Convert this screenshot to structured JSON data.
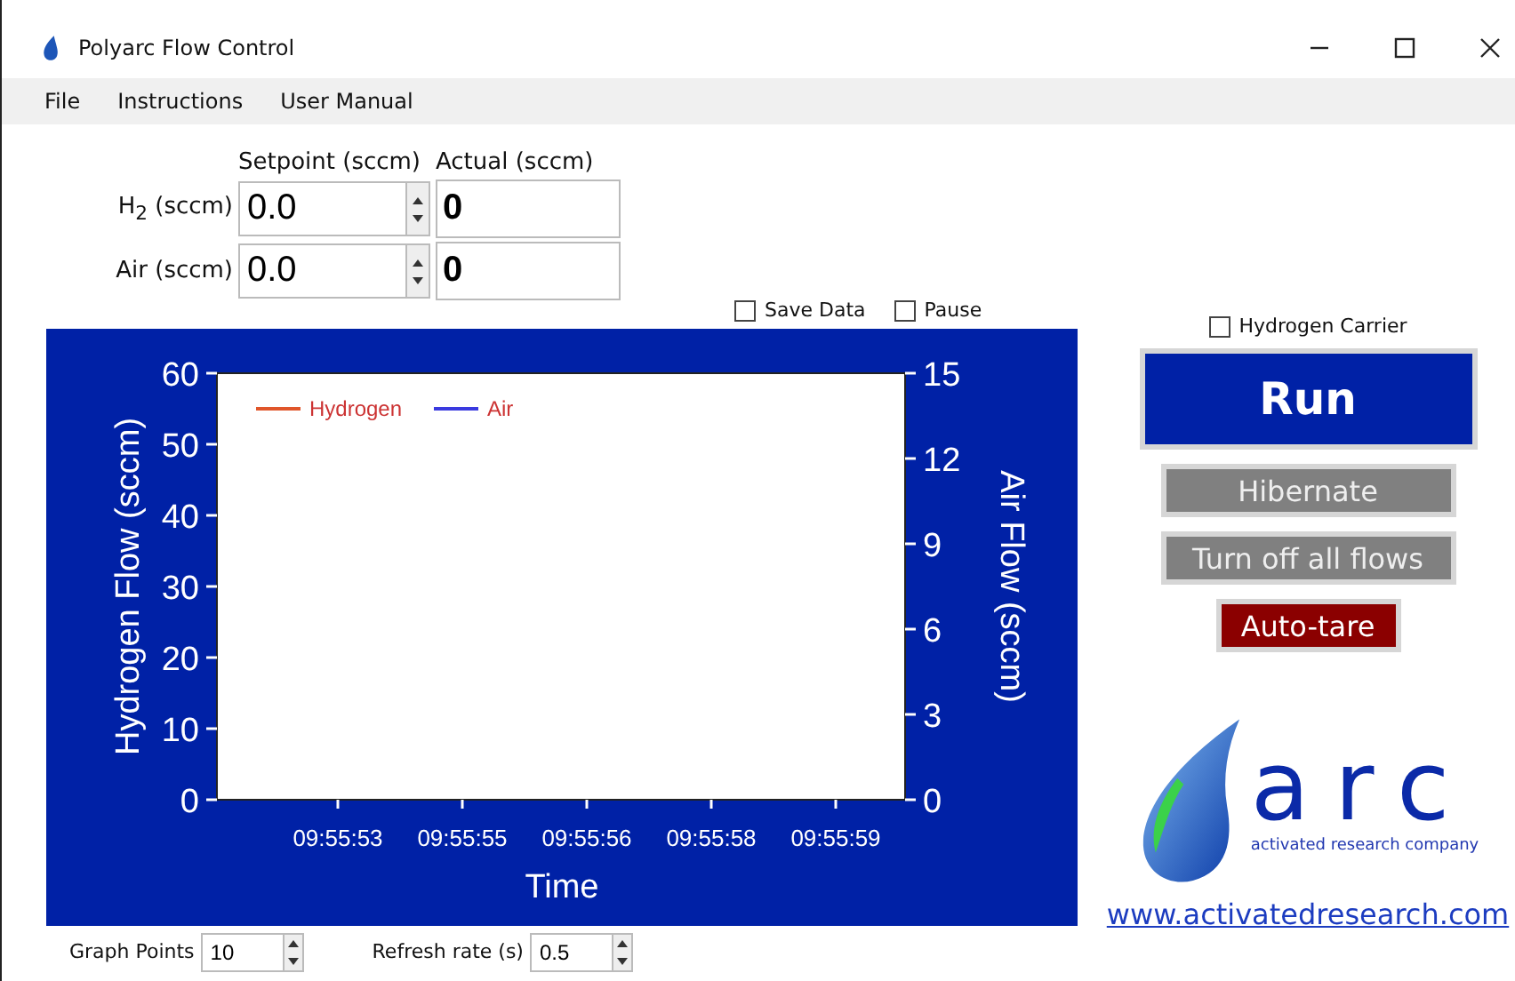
{
  "window": {
    "title": "Polyarc Flow Control"
  },
  "menu": [
    "File",
    "Instructions",
    "User Manual"
  ],
  "flow_table": {
    "columns": [
      "Setpoint (sccm)",
      "Actual (sccm)"
    ],
    "rows": [
      {
        "label": "H$_{2}$ (sccm)",
        "setpoint": "0.0",
        "actual": "0"
      },
      {
        "label": "Air (sccm)",
        "setpoint": "0.0",
        "actual": "0"
      }
    ]
  },
  "options": [
    {
      "label": "Save Data",
      "checked": false
    },
    {
      "label": "Pause",
      "checked": false
    }
  ],
  "chart": {
    "chart_data": {
      "type": "line",
      "xlabel": "Time",
      "ylabel": "Hydrogen Flow (sccm)",
      "y2label": "Air Flow (sccm)",
      "categories": [
        "09:55:53",
        "09:55:55",
        "09:55:56",
        "09:55:58",
        "09:55:59"
      ],
      "legend": "upper left",
      "series": [
        {
          "name": "Hydrogen",
          "color": "#e0562a",
          "values": [
            null,
            null,
            null,
            null,
            null
          ]
        },
        {
          "name": "Air",
          "color": "#3a3adf",
          "values": [
            null,
            null,
            null,
            null,
            null
          ]
        }
      ],
      "ylim": [
        0,
        60
      ],
      "yticks": [
        0,
        10,
        20,
        30,
        40,
        50,
        60
      ],
      "y2lim": [
        0,
        15
      ],
      "y2ticks": [
        0,
        3,
        6,
        9,
        12,
        15
      ]
    }
  },
  "graph_points": {
    "label": "Graph Points",
    "value": "10"
  },
  "refresh_rate": {
    "label": "Refresh rate (s)",
    "value": "0.5"
  },
  "hydrogen_carrier": {
    "label": "Hydrogen Carrier",
    "checked": false
  },
  "buttons": [
    {
      "label": "Run",
      "kind": "primary"
    },
    {
      "label": "Hibernate",
      "kind": "secondary"
    },
    {
      "label": "Turn off all flows",
      "kind": "secondary"
    },
    {
      "label": "Auto-tare",
      "kind": "danger"
    }
  ],
  "logo": {
    "name": "arc",
    "tagline": "activated research company"
  },
  "link": "www.activatedresearch.com"
}
